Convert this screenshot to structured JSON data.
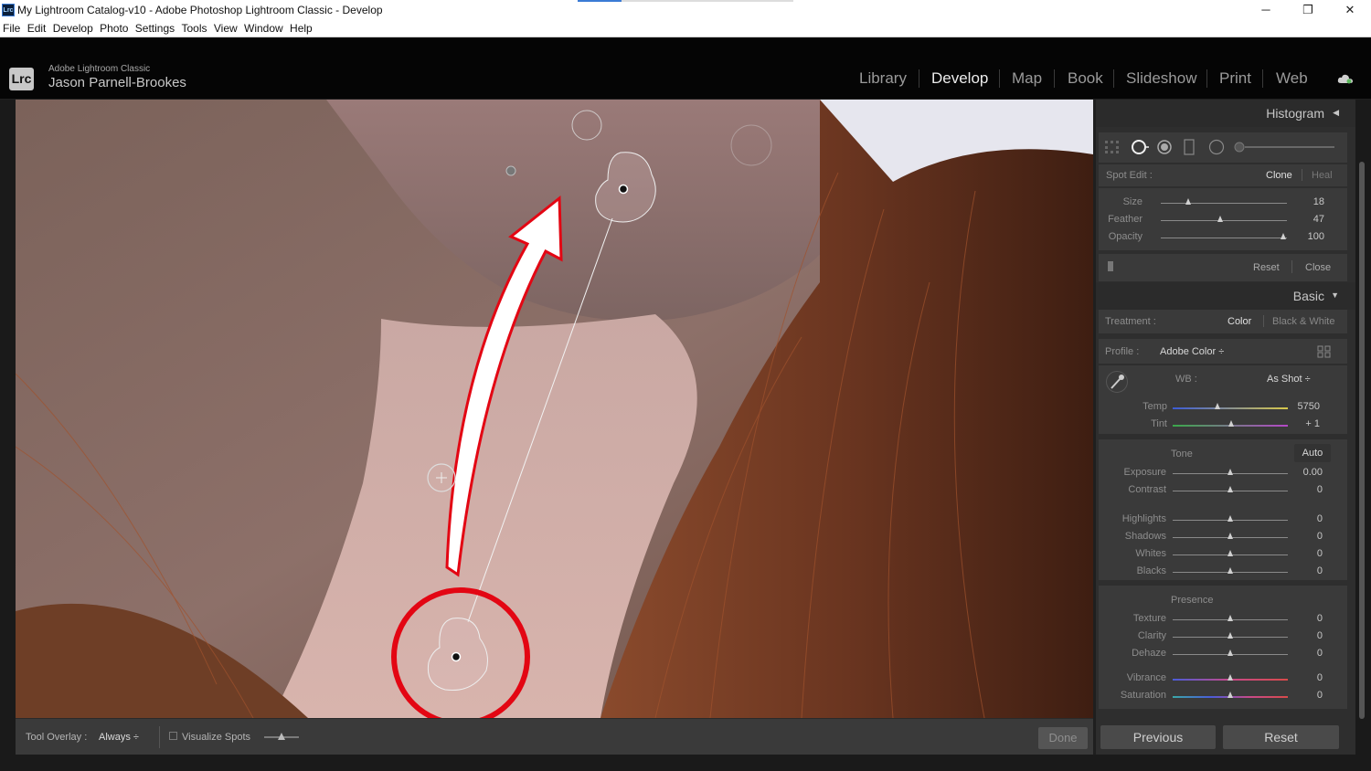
{
  "window": {
    "title": "My Lightroom Catalog-v10 - Adobe Photoshop Lightroom Classic - Develop",
    "app_icon": "Lrc",
    "minimize": "─",
    "maximize": "❐",
    "close": "✕"
  },
  "menu": [
    "File",
    "Edit",
    "Develop",
    "Photo",
    "Settings",
    "Tools",
    "View",
    "Window",
    "Help"
  ],
  "identity": {
    "logo": "Lrc",
    "app_name": "Adobe Lightroom Classic",
    "user": "Jason Parnell-Brookes"
  },
  "modules": [
    "Library",
    "Develop",
    "Map",
    "Book",
    "Slideshow",
    "Print",
    "Web"
  ],
  "active_module": "Develop",
  "colors": {
    "accent_red": "#e30613",
    "panel_bg": "#2e2e2e",
    "section_bg": "#3a3a3a"
  },
  "histogram": {
    "title": "Histogram",
    "collapse_arrow": "◀"
  },
  "spot_edit": {
    "label": "Spot Edit :",
    "mode_clone": "Clone",
    "mode_heal": "Heal",
    "sliders": [
      {
        "label": "Size",
        "value": "18",
        "pos": 0.22
      },
      {
        "label": "Feather",
        "value": "47",
        "pos": 0.47
      },
      {
        "label": "Opacity",
        "value": "100",
        "pos": 0.97
      }
    ],
    "reset": "Reset",
    "close": "Close"
  },
  "basic": {
    "title": "Basic",
    "collapse_arrow": "▼",
    "treatment_label": "Treatment :",
    "treatment_color": "Color",
    "treatment_bw": "Black & White",
    "profile_label": "Profile :",
    "profile_value": "Adobe Color ÷",
    "wb_label": "WB :",
    "wb_value": "As Shot ÷",
    "temp": {
      "label": "Temp",
      "value": "5750",
      "pos": 0.39
    },
    "tint": {
      "label": "Tint",
      "value": "+ 1",
      "pos": 0.51
    },
    "tone_label": "Tone",
    "auto": "Auto",
    "tone": [
      {
        "label": "Exposure",
        "value": "0.00",
        "pos": 0.5
      },
      {
        "label": "Contrast",
        "value": "0",
        "pos": 0.5
      }
    ],
    "tone2": [
      {
        "label": "Highlights",
        "value": "0",
        "pos": 0.5
      },
      {
        "label": "Shadows",
        "value": "0",
        "pos": 0.5
      },
      {
        "label": "Whites",
        "value": "0",
        "pos": 0.5
      },
      {
        "label": "Blacks",
        "value": "0",
        "pos": 0.5
      }
    ],
    "presence_label": "Presence",
    "presence": [
      {
        "label": "Texture",
        "value": "0",
        "pos": 0.5
      },
      {
        "label": "Clarity",
        "value": "0",
        "pos": 0.5
      },
      {
        "label": "Dehaze",
        "value": "0",
        "pos": 0.5
      }
    ],
    "presence2": [
      {
        "label": "Vibrance",
        "value": "0",
        "pos": 0.5
      },
      {
        "label": "Saturation",
        "value": "0",
        "pos": 0.5
      }
    ]
  },
  "toolbar": {
    "tool_overlay_label": "Tool Overlay :",
    "tool_overlay_value": "Always ÷",
    "visualize_spots": "Visualize Spots",
    "done": "Done"
  },
  "footer": {
    "previous": "Previous",
    "reset": "Reset"
  }
}
